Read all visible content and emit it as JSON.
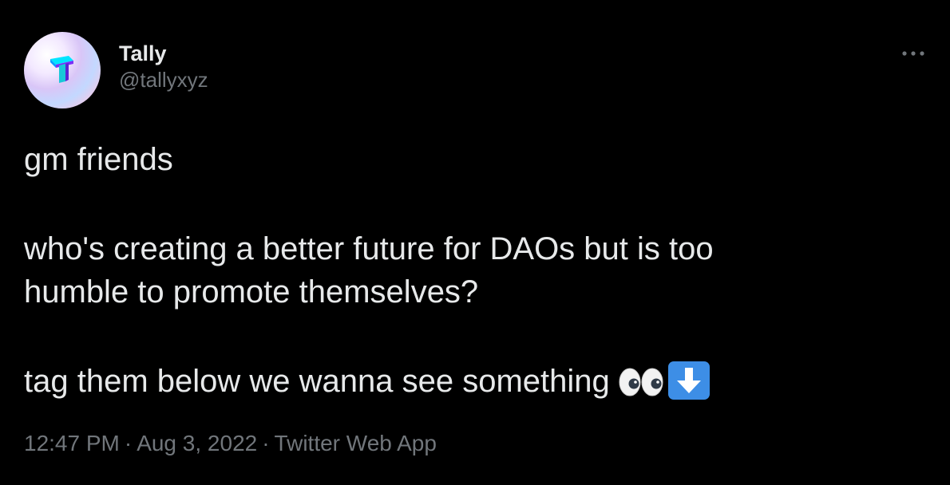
{
  "author": {
    "display_name": "Tally",
    "handle": "@tallyxyz",
    "avatar_icon": "tally-logo-icon"
  },
  "tweet": {
    "lines": [
      "gm friends",
      "who's creating a better future for DAOs but is too",
      "humble to promote themselves?",
      "tag them below we wanna see something"
    ],
    "emojis": [
      "eyes-emoji-icon",
      "down-arrow-emoji-icon"
    ]
  },
  "meta": {
    "time": "12:47 PM",
    "separator": "·",
    "date": "Aug 3, 2022",
    "source": "Twitter Web App"
  },
  "colors": {
    "background": "#000000",
    "primary_text": "#e7e9ea",
    "secondary_text": "#71767b",
    "arrow_emoji_blue": "#3d8ee6"
  }
}
